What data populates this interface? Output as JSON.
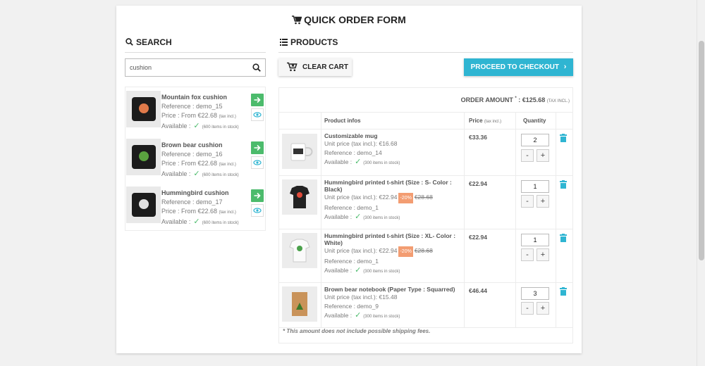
{
  "title": "QUICK ORDER FORM",
  "search": {
    "heading": "SEARCH",
    "value": "cushion",
    "results": [
      {
        "name": "Mountain fox cushion",
        "reference": "Reference : demo_15",
        "price": "Price : From €22.68",
        "tax": "(tax incl.)",
        "available": "Available :",
        "stock": "(600 items in stock)"
      },
      {
        "name": "Brown bear cushion",
        "reference": "Reference : demo_16",
        "price": "Price : From €22.68",
        "tax": "(tax incl.)",
        "available": "Available :",
        "stock": "(600 items in stock)"
      },
      {
        "name": "Hummingbird cushion",
        "reference": "Reference : demo_17",
        "price": "Price : From €22.68",
        "tax": "(tax incl.)",
        "available": "Available :",
        "stock": "(600 items in stock)"
      }
    ]
  },
  "products": {
    "heading": "PRODUCTS",
    "clear_label": "CLEAR CART",
    "checkout_label": "PROCEED TO CHECKOUT",
    "order_amount_label": "ORDER AMOUNT",
    "order_amount_star": "*",
    "order_amount_value": ": €125.68",
    "order_amount_tax": "(TAX INCL.)",
    "columns": {
      "info": "Product infos",
      "price": "Price",
      "price_tax": "(tax incl.)",
      "quantity": "Quantity"
    },
    "rows": [
      {
        "name": "Customizable mug",
        "unit": "Unit price (tax incl.): €16.68",
        "discount": "",
        "old_price": "",
        "reference": "Reference : demo_14",
        "available": "Available :",
        "stock": "(300 items in stock)",
        "price": "€33.36",
        "qty": "2"
      },
      {
        "name": "Hummingbird printed t-shirt (Size : S- Color : Black)",
        "unit": "Unit price (tax incl.): €22.94",
        "discount": "-20%",
        "old_price": "€28.68",
        "reference": "Reference : demo_1",
        "available": "Available :",
        "stock": "(300 items in stock)",
        "price": "€22.94",
        "qty": "1"
      },
      {
        "name": "Hummingbird printed t-shirt (Size : XL- Color : White)",
        "unit": "Unit price (tax incl.): €22.94",
        "discount": "-20%",
        "old_price": "€28.68",
        "reference": "Reference : demo_1",
        "available": "Available :",
        "stock": "(300 items in stock)",
        "price": "€22.94",
        "qty": "1"
      },
      {
        "name": "Brown bear notebook (Paper Type : Squarred)",
        "unit": "Unit price (tax incl.): €15.48",
        "discount": "",
        "old_price": "",
        "reference": "Reference : demo_9",
        "available": "Available :",
        "stock": "(300 items in stock)",
        "price": "€46.44",
        "qty": "3"
      }
    ],
    "note": "* This amount does not include possible shipping fees."
  },
  "colors": {
    "accent": "#2fb5d2",
    "success": "#4cbb6c",
    "discount": "#f39d72"
  },
  "icons": {
    "cart": "cart-icon",
    "search": "search-icon",
    "list": "list-icon",
    "trash": "trash-icon",
    "eye": "eye-icon",
    "arrow": "arrow-right-icon"
  }
}
